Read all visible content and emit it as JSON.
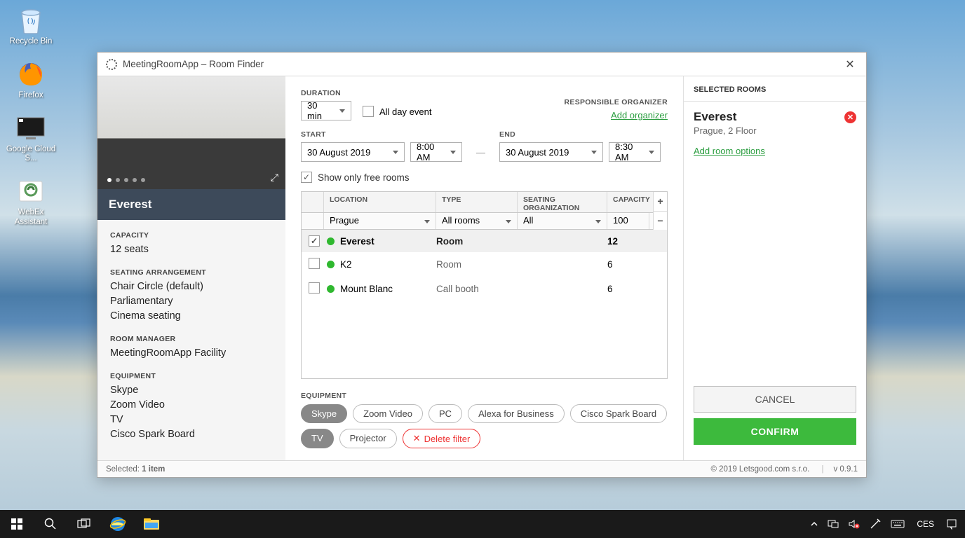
{
  "desktop": {
    "icons": [
      {
        "name": "recycle-bin",
        "label": "Recycle Bin"
      },
      {
        "name": "firefox",
        "label": "Firefox"
      },
      {
        "name": "google-cloud",
        "label": "Google Cloud S..."
      },
      {
        "name": "webex",
        "label": "WebEx Assistant"
      }
    ]
  },
  "titlebar": {
    "title": "MeetingRoomApp – Room Finder"
  },
  "left": {
    "room_name": "Everest",
    "capacity_h": "CAPACITY",
    "capacity": "12 seats",
    "seating_h": "SEATING ARRANGEMENT",
    "seating": [
      "Chair Circle (default)",
      "Parliamentary",
      "Cinema seating"
    ],
    "manager_h": "ROOM MANAGER",
    "manager": "MeetingRoomApp Facility",
    "equipment_h": "EQUIPMENT",
    "equipment": [
      "Skype",
      "Zoom Video",
      "TV",
      "Cisco Spark Board"
    ]
  },
  "center": {
    "duration_h": "DURATION",
    "duration_val": "30 min",
    "allday": "All day event",
    "organizer_h": "RESPONSIBLE ORGANIZER",
    "add_organizer": "Add organizer",
    "start_h": "START",
    "end_h": "END",
    "start_date": "30 August 2019",
    "start_time": "8:00 AM",
    "end_date": "30 August 2019",
    "end_time": "8:30 AM",
    "free_rooms": "Show only free rooms",
    "cols": {
      "loc": "LOCATION",
      "type": "TYPE",
      "seat": "SEATING ORGANIZATION",
      "cap": "CAPACITY"
    },
    "filters": {
      "loc": "Prague",
      "type": "All rooms",
      "seat": "All",
      "cap": "100"
    },
    "rooms": [
      {
        "checked": true,
        "name": "Everest",
        "type": "Room",
        "cap": "12",
        "selected": true
      },
      {
        "checked": false,
        "name": "K2",
        "type": "Room",
        "cap": "6",
        "selected": false
      },
      {
        "checked": false,
        "name": "Mount Blanc",
        "type": "Call booth",
        "cap": "6",
        "selected": false
      }
    ],
    "equip_h": "EQUIPMENT",
    "equip_pills": [
      {
        "label": "Skype",
        "active": true
      },
      {
        "label": "Zoom Video",
        "active": false
      },
      {
        "label": "PC",
        "active": false
      },
      {
        "label": "Alexa for Business",
        "active": false
      },
      {
        "label": "Cisco Spark Board",
        "active": false
      },
      {
        "label": "TV",
        "active": true
      },
      {
        "label": "Projector",
        "active": false
      }
    ],
    "delete_filter": "Delete filter"
  },
  "right": {
    "header": "SELECTED ROOMS",
    "room_name": "Everest",
    "room_loc": "Prague, 2 Floor",
    "add_opts": "Add room options",
    "cancel": "CANCEL",
    "confirm": "CONFIRM"
  },
  "status": {
    "selected_l": "Selected: ",
    "selected_v": "1 item",
    "copyright": "© 2019 Letsgood.com s.r.o.",
    "version": "v 0.9.1"
  },
  "taskbar": {
    "lang": "CES"
  }
}
